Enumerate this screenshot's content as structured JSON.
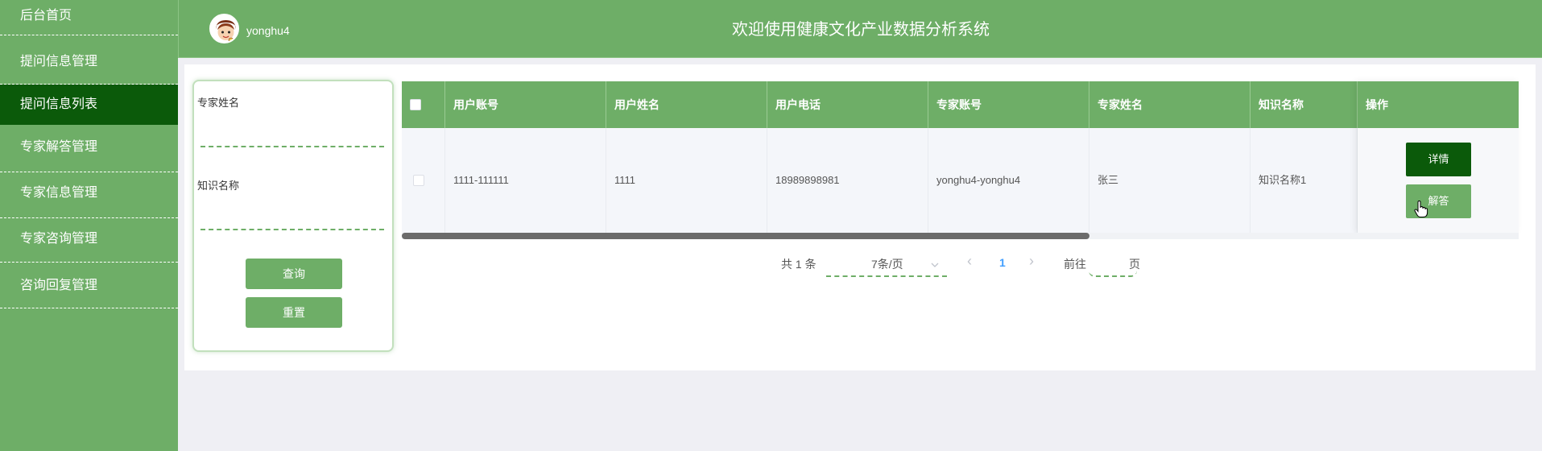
{
  "sidebar": {
    "items": [
      {
        "label": "后台首页"
      },
      {
        "label": "提问信息管理"
      },
      {
        "label": "提问信息列表"
      },
      {
        "label": "专家解答管理"
      },
      {
        "label": "专家信息管理"
      },
      {
        "label": "专家咨询管理"
      },
      {
        "label": "咨询回复管理"
      }
    ]
  },
  "header": {
    "username": "yonghu4",
    "title": "欢迎使用健康文化产业数据分析系统"
  },
  "search": {
    "expert_name_label": "专家姓名",
    "expert_name_value": "",
    "knowledge_label": "知识名称",
    "knowledge_value": "",
    "query_button": "查询",
    "reset_button": "重置"
  },
  "table": {
    "columns": [
      "用户账号",
      "用户姓名",
      "用户电话",
      "专家账号",
      "专家姓名",
      "知识名称",
      "操作"
    ],
    "rows": [
      {
        "user_account": "1111-111111",
        "user_name": "1111",
        "user_phone": "18989898981",
        "expert_account": "yonghu4-yonghu4",
        "expert_name": "张三",
        "knowledge_name": "知识名称1",
        "actions": {
          "detail": "详情",
          "answer": "解答"
        }
      }
    ]
  },
  "pagination": {
    "total_text": "共 1 条",
    "page_size": "7条/页",
    "prev": "‹",
    "current_page": "1",
    "next": "›",
    "goto_label": "前往",
    "page_unit": "页"
  },
  "colors": {
    "primary": "#6eae67",
    "dark": "#0b5a0a",
    "background": "#efeff4"
  }
}
